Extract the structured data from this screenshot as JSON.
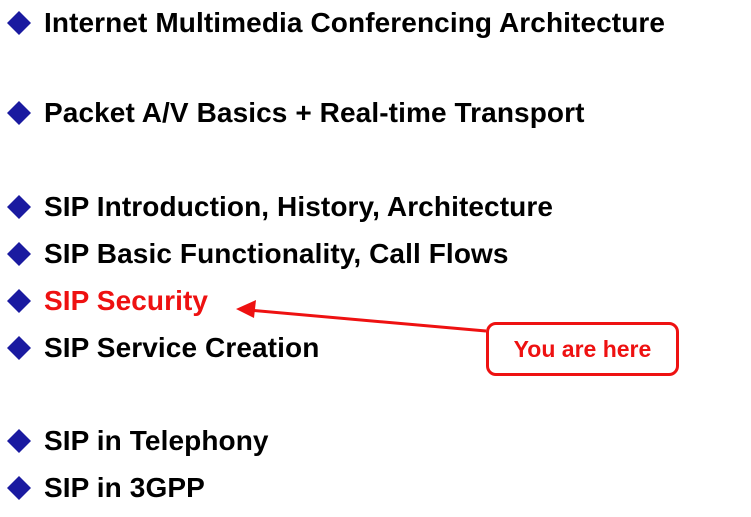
{
  "agenda": {
    "items": [
      {
        "label": "Internet Multimedia Conferencing Architecture",
        "current": false
      },
      {
        "label": "Packet A/V Basics + Real-time Transport",
        "current": false
      },
      {
        "label": "SIP Introduction, History, Architecture",
        "current": false
      },
      {
        "label": "SIP Basic Functionality, Call Flows",
        "current": false
      },
      {
        "label": "SIP Security",
        "current": true
      },
      {
        "label": "SIP Service Creation",
        "current": false
      },
      {
        "label": "SIP in Telephony",
        "current": false
      },
      {
        "label": "SIP in 3GPP",
        "current": false
      }
    ]
  },
  "callout": {
    "text": "You are here"
  },
  "colors": {
    "bullet": "#1a1aa0",
    "highlight": "#ee1111",
    "text": "#000000"
  },
  "icons": {
    "bullet": "diamond-bullet-icon",
    "pointer": "arrow-left-icon"
  }
}
